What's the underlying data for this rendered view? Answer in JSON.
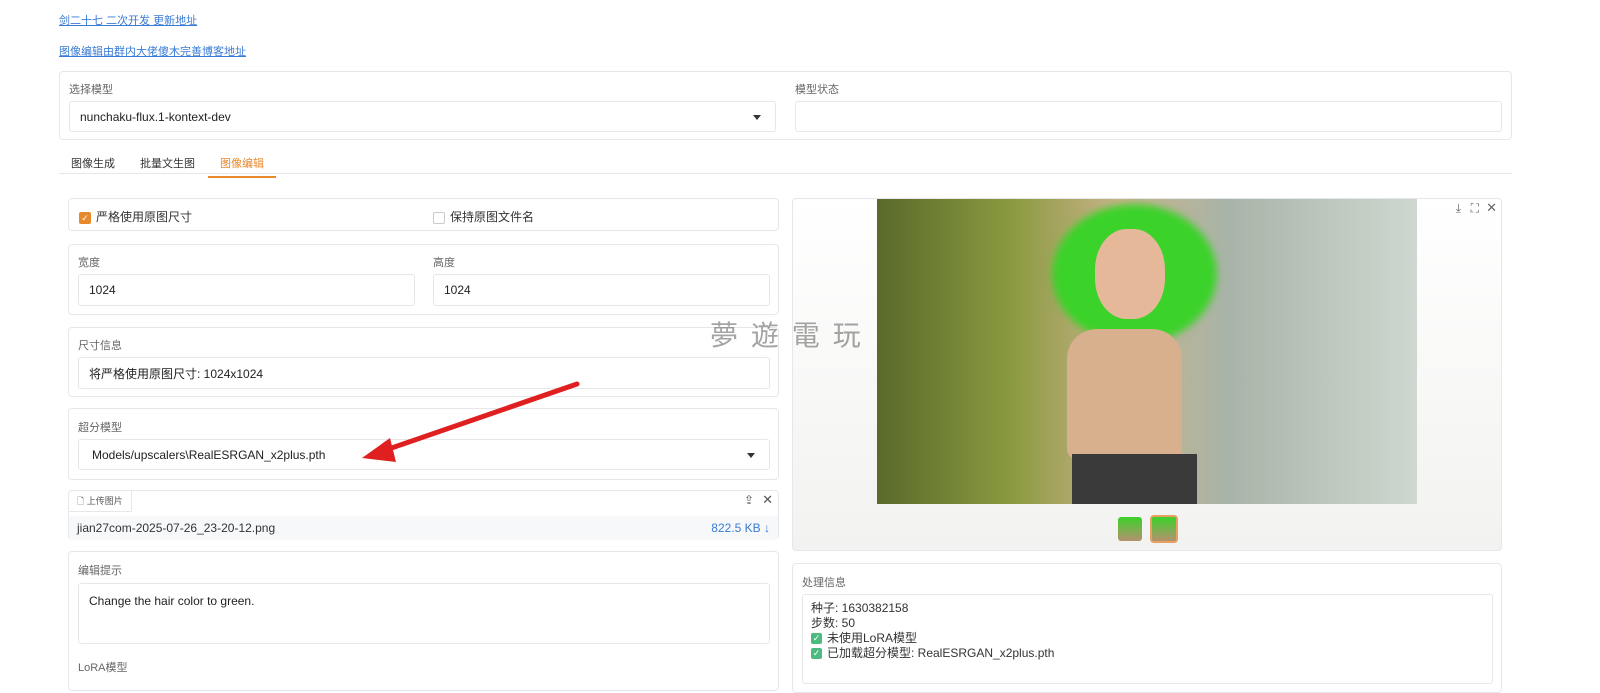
{
  "links": {
    "update": "剑二十七 二次开发 更新地址",
    "blog": "图像编辑由群内大佬傻木完善博客地址"
  },
  "model": {
    "label": "选择模型",
    "value": "nunchaku-flux.1-kontext-dev",
    "status_label": "模型状态",
    "status_value": ""
  },
  "tabs": [
    {
      "label": "图像生成"
    },
    {
      "label": "批量文生图"
    },
    {
      "label": "图像编辑",
      "active": true
    }
  ],
  "left": {
    "strict_size": {
      "label": "严格使用原图尺寸",
      "checked": true
    },
    "keep_name": {
      "label": "保持原图文件名",
      "checked": false
    },
    "width": {
      "label": "宽度",
      "value": "1024"
    },
    "height": {
      "label": "高度",
      "value": "1024"
    },
    "size_info": {
      "label": "尺寸信息",
      "value": "将严格使用原图尺寸: 1024x1024"
    },
    "upscaler": {
      "label": "超分模型",
      "value": "Models/upscalers\\RealESRGAN_x2plus.pth"
    },
    "upload": {
      "label": "上传图片",
      "filename": "jian27com-2025-07-26_23-20-12.png",
      "size": "822.5 KB ↓"
    },
    "prompt": {
      "label": "编辑提示",
      "value": "Change the hair color to green."
    },
    "lora": {
      "label": "LoRA模型"
    }
  },
  "right": {
    "info": {
      "label": "处理信息",
      "lines": [
        "种子: 1630382158",
        "步数: 50"
      ],
      "checks": [
        "未使用LoRA模型",
        "已加载超分模型: RealESRGAN_x2plus.pth"
      ]
    }
  },
  "watermark": "夢 遊 電 玩",
  "colors": {
    "accent": "#e8892c",
    "link": "#3a7bd5",
    "arrow": "#e02020"
  }
}
